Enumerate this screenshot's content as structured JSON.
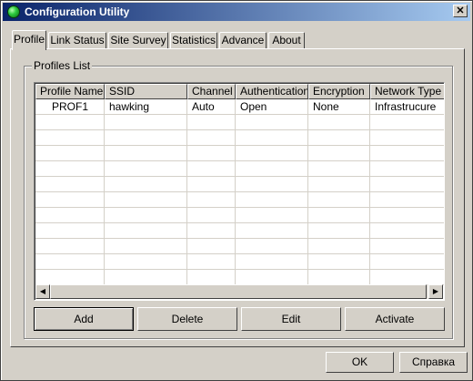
{
  "window": {
    "title": "Configuration Utility",
    "close_glyph": "✕"
  },
  "icons": {
    "app": "green-orb-icon",
    "close": "close-icon",
    "left": "arrow-left-icon",
    "right": "arrow-right-icon"
  },
  "tabs": [
    {
      "label": "Profile",
      "active": true
    },
    {
      "label": "Link Status"
    },
    {
      "label": "Site Survey"
    },
    {
      "label": "Statistics"
    },
    {
      "label": "Advance"
    },
    {
      "label": "About"
    }
  ],
  "profiles": {
    "group_label": "Profiles List",
    "columns": [
      "Profile Name",
      "SSID",
      "Channel",
      "Authentication",
      "Encryption",
      "Network Type"
    ],
    "rows": [
      [
        "PROF1",
        "hawking",
        "Auto",
        "Open",
        "None",
        "Infrastrucure"
      ]
    ],
    "buttons": {
      "add": "Add",
      "delete": "Delete",
      "edit": "Edit",
      "activate": "Activate"
    },
    "scroll": {
      "left": "◀",
      "right": "▶"
    }
  },
  "dialog": {
    "ok": "OK",
    "help": "Справка"
  }
}
